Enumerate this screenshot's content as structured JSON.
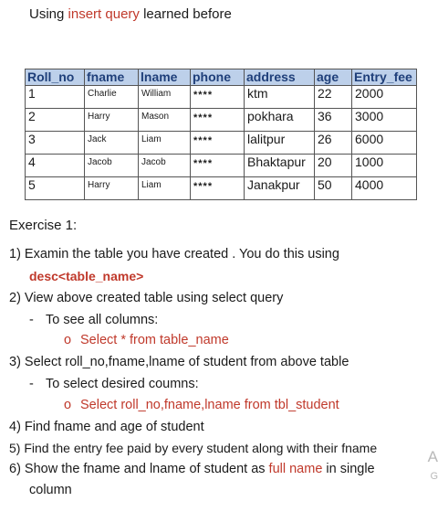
{
  "intro": {
    "prefix": "Using ",
    "highlight": "insert query",
    "suffix": " learned before"
  },
  "table": {
    "headers": [
      "Roll_no",
      "fname",
      "lname",
      "phone",
      "address",
      "age",
      "Entry_fee"
    ],
    "rows": [
      [
        "1",
        "Charlie",
        "William",
        "****",
        "ktm",
        "22",
        "2000"
      ],
      [
        "2",
        "Harry",
        "Mason",
        "****",
        "pokhara",
        "36",
        "3000"
      ],
      [
        "3",
        "Jack",
        "Liam",
        "****",
        "lalitpur",
        "26",
        "6000"
      ],
      [
        "4",
        "Jacob",
        "Jacob",
        "****",
        "Bhaktapur",
        "20",
        "1000"
      ],
      [
        "5",
        "Harry",
        "Liam",
        "****",
        "Janakpur",
        "50",
        "4000"
      ]
    ]
  },
  "exercise": {
    "title": "Exercise 1:",
    "q1": "1) Examin the table you have created . You  do this using",
    "q1_code": "desc<table_name>",
    "q2": "2) View above created table using select query",
    "q2_sub": "To see all columns:",
    "q2_bullet": "Select * from table_name",
    "q3": "3) Select roll_no,fname,lname of student from above table",
    "q3_sub": "To select desired coumns:",
    "q3_bullet": "Select roll_no,fname,lname from tbl_student",
    "q4": "4) Find fname and age of student",
    "q5": "5) Find the entry fee paid by every student along with their fname",
    "q6_prefix": "6) Show the fname and lname of student as ",
    "q6_highlight": "full name",
    "q6_suffix": " in single",
    "q6_cont": "column",
    "dash": "-",
    "bullet_mark": "o"
  },
  "edge_text": {
    "a": "A",
    "g": "G"
  }
}
